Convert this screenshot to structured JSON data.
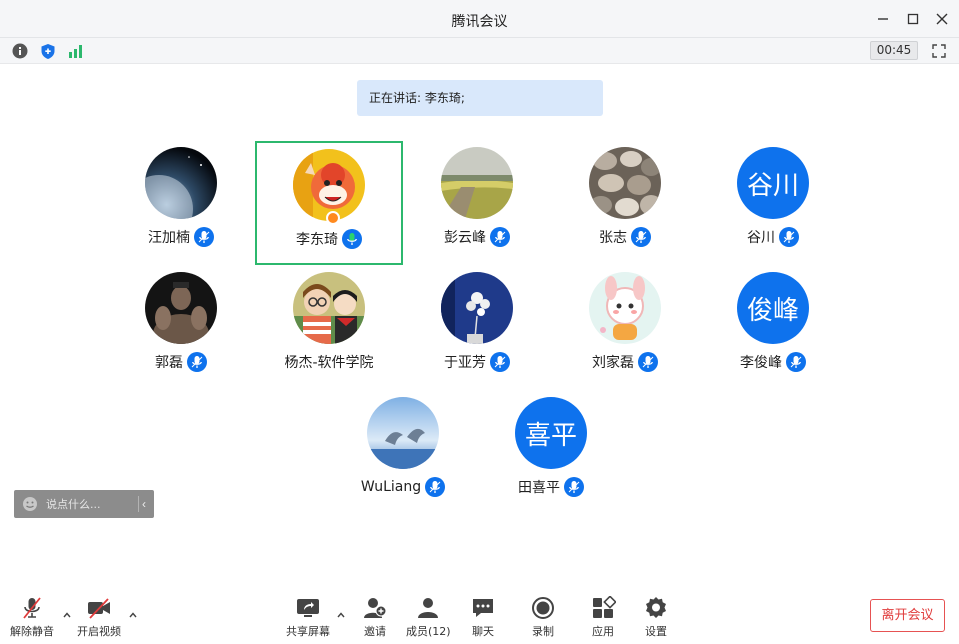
{
  "window": {
    "title": "腾讯会议"
  },
  "toolbar": {
    "timer": "00:45"
  },
  "speaking": {
    "text": "正在讲话: 李东琦;"
  },
  "participants": [
    {
      "name": "汪加楠",
      "avatar": "earth-space-photo"
    },
    {
      "name": "李东琦",
      "avatar": "cartoon-character",
      "active": true,
      "host": true
    },
    {
      "name": "彭云峰",
      "avatar": "field-photo"
    },
    {
      "name": "张志",
      "avatar": "pebbles-photo"
    },
    {
      "name": "谷川",
      "avatar_text": "谷川"
    },
    {
      "name": "郭磊",
      "avatar": "muscle-man-photo"
    },
    {
      "name": "杨杰-软件学院",
      "avatar": "anime-characters"
    },
    {
      "name": "于亚芳",
      "avatar": "flowers-photo"
    },
    {
      "name": "刘家磊",
      "avatar": "cute-cartoon"
    },
    {
      "name": "李俊峰",
      "avatar_text": "俊峰"
    },
    {
      "name": "WuLiang",
      "avatar": "dolphins-photo"
    },
    {
      "name": "田喜平",
      "avatar_text": "喜平"
    }
  ],
  "chat": {
    "placeholder": "说点什么..."
  },
  "bottombar": {
    "unmute": "解除静音",
    "start_video": "开启视频",
    "share_screen": "共享屏幕",
    "invite": "邀请",
    "members": "成员(12)",
    "chat": "聊天",
    "record": "录制",
    "apps": "应用",
    "settings": "设置",
    "leave": "离开会议"
  },
  "colors": {
    "accent": "#0e72ed",
    "speaking_border": "#2cb86d",
    "leave": "#e03b3b",
    "banner": "#d9e8fb"
  }
}
